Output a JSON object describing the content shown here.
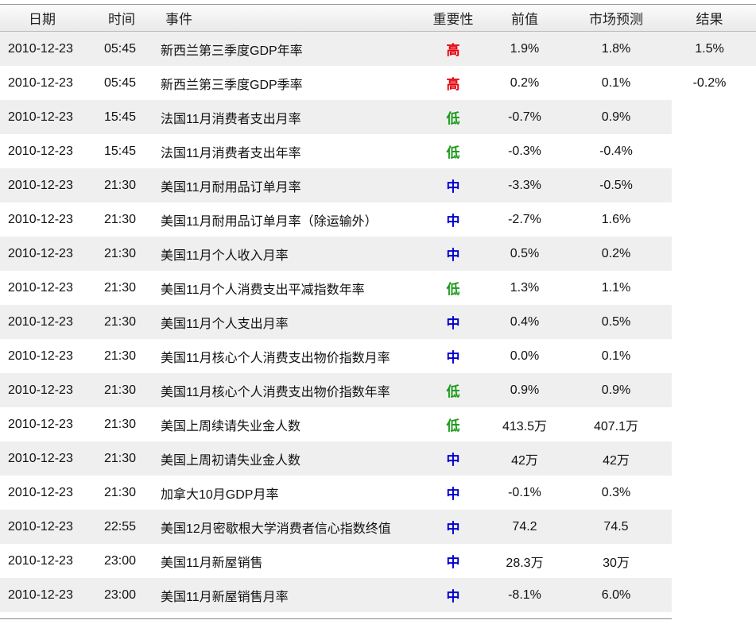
{
  "header": {
    "date": "日期",
    "time": "时间",
    "event": "事件",
    "importance": "重要性",
    "previous": "前值",
    "forecast": "市场预测",
    "result": "结果"
  },
  "importance_colors": {
    "高": "#e8000b",
    "中": "#0000cc",
    "低": "#1a9a1a"
  },
  "rows": [
    {
      "date": "2010-12-23",
      "time": "05:45",
      "event": "新西兰第三季度GDP年率",
      "importance": "高",
      "previous": "1.9%",
      "forecast": "1.8%",
      "result": "1.5%"
    },
    {
      "date": "2010-12-23",
      "time": "05:45",
      "event": "新西兰第三季度GDP季率",
      "importance": "高",
      "previous": "0.2%",
      "forecast": "0.1%",
      "result": "-0.2%"
    },
    {
      "date": "2010-12-23",
      "time": "15:45",
      "event": "法国11月消费者支出月率",
      "importance": "低",
      "previous": "-0.7%",
      "forecast": "0.9%",
      "result": ""
    },
    {
      "date": "2010-12-23",
      "time": "15:45",
      "event": "法国11月消费者支出年率",
      "importance": "低",
      "previous": "-0.3%",
      "forecast": "-0.4%",
      "result": ""
    },
    {
      "date": "2010-12-23",
      "time": "21:30",
      "event": "美国11月耐用品订单月率",
      "importance": "中",
      "previous": "-3.3%",
      "forecast": "-0.5%",
      "result": ""
    },
    {
      "date": "2010-12-23",
      "time": "21:30",
      "event": "美国11月耐用品订单月率（除运输外）",
      "importance": "中",
      "previous": "-2.7%",
      "forecast": "1.6%",
      "result": ""
    },
    {
      "date": "2010-12-23",
      "time": "21:30",
      "event": "美国11月个人收入月率",
      "importance": "中",
      "previous": "0.5%",
      "forecast": "0.2%",
      "result": ""
    },
    {
      "date": "2010-12-23",
      "time": "21:30",
      "event": "美国11月个人消费支出平减指数年率",
      "importance": "低",
      "previous": "1.3%",
      "forecast": "1.1%",
      "result": ""
    },
    {
      "date": "2010-12-23",
      "time": "21:30",
      "event": "美国11月个人支出月率",
      "importance": "中",
      "previous": "0.4%",
      "forecast": "0.5%",
      "result": ""
    },
    {
      "date": "2010-12-23",
      "time": "21:30",
      "event": "美国11月核心个人消费支出物价指数月率",
      "importance": "中",
      "previous": "0.0%",
      "forecast": "0.1%",
      "result": ""
    },
    {
      "date": "2010-12-23",
      "time": "21:30",
      "event": "美国11月核心个人消费支出物价指数年率",
      "importance": "低",
      "previous": "0.9%",
      "forecast": "0.9%",
      "result": ""
    },
    {
      "date": "2010-12-23",
      "time": "21:30",
      "event": "美国上周续请失业金人数",
      "importance": "低",
      "previous": "413.5万",
      "forecast": "407.1万",
      "result": ""
    },
    {
      "date": "2010-12-23",
      "time": "21:30",
      "event": "美国上周初请失业金人数",
      "importance": "中",
      "previous": "42万",
      "forecast": "42万",
      "result": ""
    },
    {
      "date": "2010-12-23",
      "time": "21:30",
      "event": "加拿大10月GDP月率",
      "importance": "中",
      "previous": "-0.1%",
      "forecast": "0.3%",
      "result": ""
    },
    {
      "date": "2010-12-23",
      "time": "22:55",
      "event": "美国12月密歇根大学消费者信心指数终值",
      "importance": "中",
      "previous": "74.2",
      "forecast": "74.5",
      "result": ""
    },
    {
      "date": "2010-12-23",
      "time": "23:00",
      "event": "美国11月新屋销售",
      "importance": "中",
      "previous": "28.3万",
      "forecast": "30万",
      "result": ""
    },
    {
      "date": "2010-12-23",
      "time": "23:00",
      "event": "美国11月新屋销售月率",
      "importance": "中",
      "previous": "-8.1%",
      "forecast": "6.0%",
      "result": ""
    }
  ]
}
